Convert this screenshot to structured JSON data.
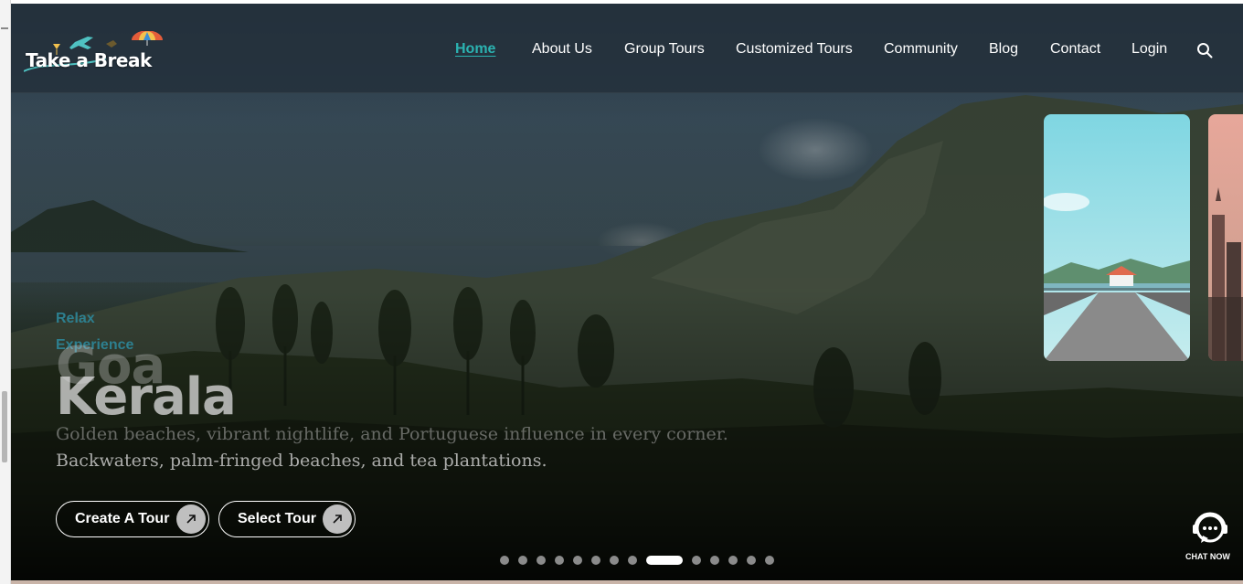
{
  "brand": {
    "name": "Take a Break",
    "accent": "#2bb3b1"
  },
  "nav": {
    "items": [
      {
        "label": "Home",
        "active": true
      },
      {
        "label": "About Us",
        "active": false
      },
      {
        "label": "Group Tours",
        "active": false
      },
      {
        "label": "Customized Tours",
        "active": false
      },
      {
        "label": "Community",
        "active": false
      },
      {
        "label": "Blog",
        "active": false
      },
      {
        "label": "Contact",
        "active": false
      },
      {
        "label": "Login",
        "active": false
      }
    ],
    "search_icon": "search-icon"
  },
  "hero": {
    "outgoing": {
      "eyebrow": "Relax",
      "title": "Goa",
      "description": "Golden beaches, vibrant nightlife, and Portuguese influence in every corner."
    },
    "current": {
      "eyebrow": "Experience",
      "title": "Kerala",
      "description": "Backwaters, palm-fringed beaches, and tea plantations."
    },
    "buttons": [
      {
        "label": "Create A Tour",
        "icon": "arrow-up-right-icon"
      },
      {
        "label": "Select Tour",
        "icon": "arrow-up-right-icon"
      }
    ]
  },
  "carousel": {
    "slide_count": 14,
    "active_index": 8
  },
  "chat": {
    "label": "CHAT NOW",
    "icon": "chat-support-icon"
  }
}
